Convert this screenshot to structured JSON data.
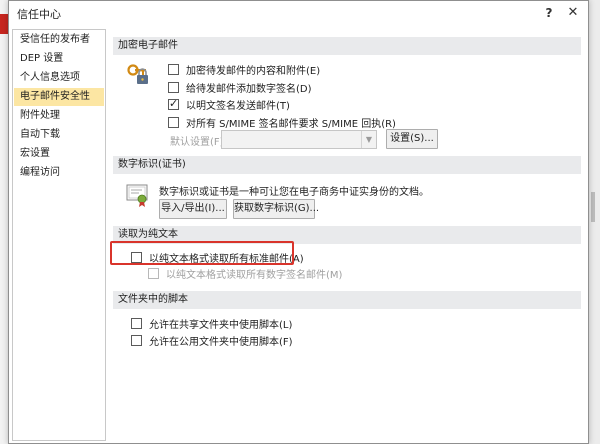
{
  "dialog": {
    "title": "信任中心",
    "help_label": "?",
    "close_label": "✕"
  },
  "sidebar": {
    "items": [
      {
        "label": "受信任的发布者",
        "selected": false
      },
      {
        "label": "DEP 设置",
        "selected": false
      },
      {
        "label": "个人信息选项",
        "selected": false
      },
      {
        "label": "电子邮件安全性",
        "selected": true
      },
      {
        "label": "附件处理",
        "selected": false
      },
      {
        "label": "自动下载",
        "selected": false
      },
      {
        "label": "宏设置",
        "selected": false
      },
      {
        "label": "编程访问",
        "selected": false
      }
    ]
  },
  "encrypted": {
    "header": "加密电子邮件",
    "icon": "lock-key-icon",
    "options": [
      {
        "label": "加密待发邮件的内容和附件(E)",
        "checked": false
      },
      {
        "label": "给待发邮件添加数字签名(D)",
        "checked": false
      },
      {
        "label": "以明文签名发送邮件(T)",
        "checked": true
      },
      {
        "label": "对所有 S/MIME 签名邮件要求 S/MIME 回执(R)",
        "checked": false
      }
    ],
    "default_setting_label": "默认设置(F):",
    "default_setting_value": "",
    "settings_button": "设置(S)..."
  },
  "digital_id": {
    "header": "数字标识(证书)",
    "icon": "certificate-icon",
    "description": "数字标识或证书是一种可让您在电子商务中证实身份的文档。",
    "import_button": "导入/导出(I)...",
    "get_button": "获取数字标识(G)..."
  },
  "plain_text": {
    "header": "读取为纯文本",
    "options": [
      {
        "label": "以纯文本格式读取所有标准邮件(A)",
        "checked": false,
        "disabled": false
      },
      {
        "label": "以纯文本格式读取所有数字签名邮件(M)",
        "checked": false,
        "disabled": true
      }
    ]
  },
  "folder_script": {
    "header": "文件夹中的脚本",
    "options": [
      {
        "label": "允许在共享文件夹中使用脚本(L)",
        "checked": false
      },
      {
        "label": "允许在公用文件夹中使用脚本(F)",
        "checked": false
      }
    ]
  },
  "colors": {
    "selected_item": "#fce6a3",
    "section_header": "#e9eaec",
    "highlight": "#d9342b"
  }
}
